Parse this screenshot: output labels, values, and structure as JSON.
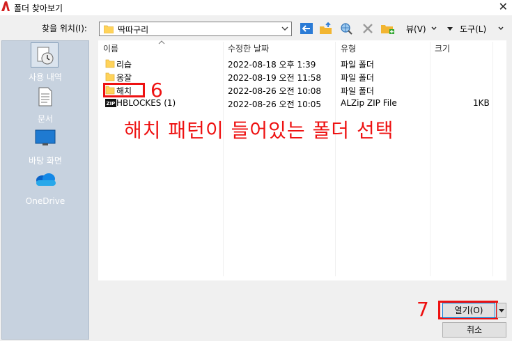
{
  "window": {
    "title": "폴더 찾아보기",
    "close_glyph": "✕"
  },
  "lookin": {
    "label": "찾을 위치(I):",
    "value": "딱따구리"
  },
  "toolbar": {
    "view_label": "뷰(V)",
    "tools_label": "도구(L)"
  },
  "places": [
    {
      "label": "사용 내역",
      "icon": "recent-icon"
    },
    {
      "label": "문서",
      "icon": "documents-icon"
    },
    {
      "label": "바탕 화면",
      "icon": "desktop-icon"
    },
    {
      "label": "OneDrive",
      "icon": "onedrive-icon"
    }
  ],
  "columns": [
    "이름",
    "수정한 날짜",
    "유형",
    "크기"
  ],
  "files": [
    {
      "name": "리습",
      "date": "2022-08-18 오후 1:39",
      "type": "파일 폴더",
      "size": "",
      "icon": "folder-icon"
    },
    {
      "name": "옹잘",
      "date": "2022-08-19 오전 11:58",
      "type": "파일 폴더",
      "size": "",
      "icon": "folder-icon"
    },
    {
      "name": "해치",
      "date": "2022-08-26 오전 10:08",
      "type": "파일 폴더",
      "size": "",
      "icon": "folder-icon"
    },
    {
      "name": "HBLOCKES (1)",
      "date": "2022-08-26 오전 10:05",
      "type": "ALZip ZIP File",
      "size": "1KB",
      "icon": "zip-icon"
    }
  ],
  "annotations": {
    "step6": "6",
    "step7": "7",
    "instruction": "해치 패턴이 들어있는 폴더 선택",
    "color": "#e11111"
  },
  "buttons": {
    "open": "열기(O)",
    "cancel": "취소"
  }
}
